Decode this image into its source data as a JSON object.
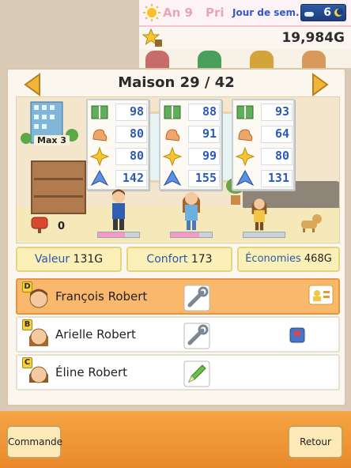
{
  "status": {
    "year": "An 9",
    "season": "Pri",
    "weekday": "Jour de sem.",
    "week_number": "6",
    "money": "19,984G"
  },
  "room": {
    "title": "Maison 29 / 42",
    "max_label": "Max 3",
    "mail_count": "0"
  },
  "stat_icons": [
    "book-icon",
    "muscle-icon",
    "spark-icon",
    "wing-icon"
  ],
  "residents_stats": [
    {
      "values": [
        "98",
        "80",
        "80",
        "142"
      ],
      "hp": 0.65
    },
    {
      "values": [
        "88",
        "91",
        "99",
        "155"
      ],
      "hp": 0.7
    },
    {
      "values": [
        "93",
        "64",
        "80",
        "131"
      ],
      "hp": 0.0
    }
  ],
  "values": {
    "valeur_label": "Valeur",
    "valeur": "131G",
    "confort_label": "Confort",
    "confort": "173",
    "economies_label": "Économies",
    "economies": "468G"
  },
  "family": [
    {
      "grade": "D",
      "name": "François Robert",
      "tool": "wrench-icon",
      "extra": "card-icon",
      "selected": true
    },
    {
      "grade": "B",
      "name": "Arielle Robert",
      "tool": "wrench-icon",
      "extra": "badge-icon",
      "selected": false
    },
    {
      "grade": "C",
      "name": "Éline Robert",
      "tool": "pencil-icon",
      "extra": "",
      "selected": false
    }
  ],
  "buttons": {
    "command": "Commande",
    "back": "Retour"
  },
  "colors": {
    "accent_orange": "#f29a38",
    "stat_blue": "#2c5ab8",
    "hp_pink": "#f29ac8",
    "selected_row": "#f9b86b"
  }
}
